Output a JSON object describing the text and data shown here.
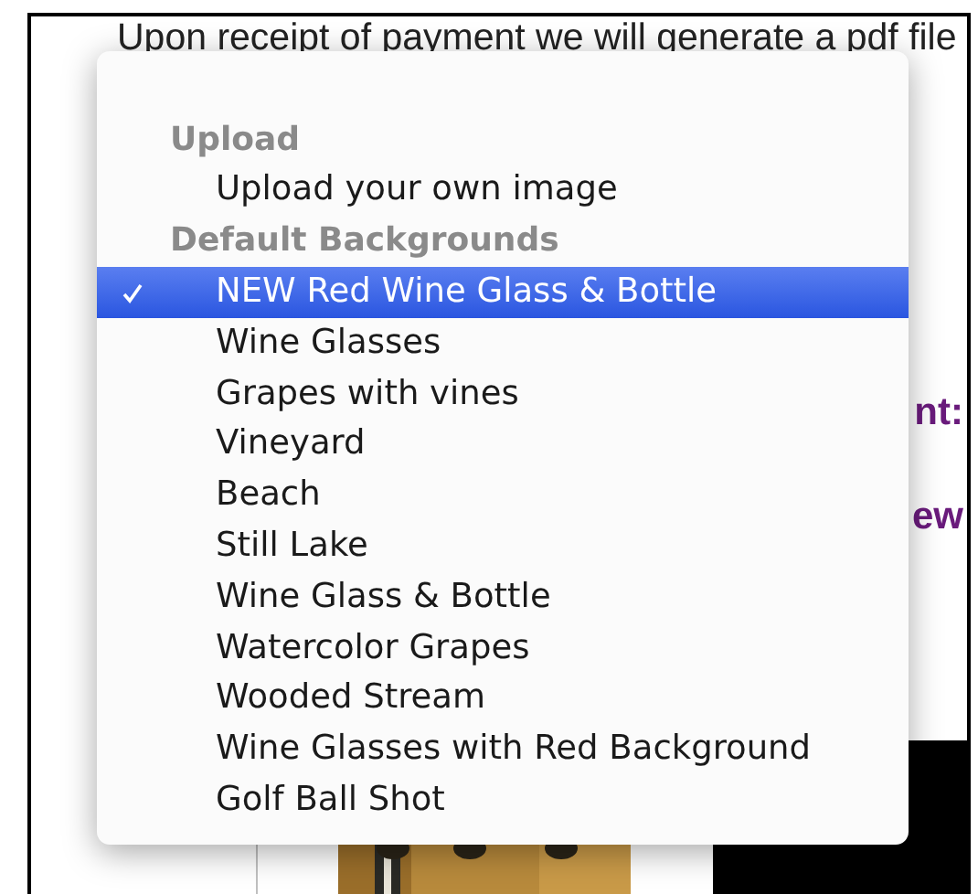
{
  "page": {
    "intro_text": "Upon receipt of payment we will generate a pdf file",
    "font_label": "nt:",
    "preview_label": "ew"
  },
  "menu": {
    "items": [
      {
        "kind": "header",
        "label": "Upload"
      },
      {
        "kind": "option",
        "label": "Upload your own image",
        "selected": false
      },
      {
        "kind": "header",
        "label": "Default Backgrounds"
      },
      {
        "kind": "option",
        "label": "NEW Red Wine Glass & Bottle",
        "selected": true
      },
      {
        "kind": "option",
        "label": "Wine Glasses",
        "selected": false
      },
      {
        "kind": "option",
        "label": "Grapes with vines",
        "selected": false
      },
      {
        "kind": "option",
        "label": "Vineyard",
        "selected": false
      },
      {
        "kind": "option",
        "label": "Beach",
        "selected": false
      },
      {
        "kind": "option",
        "label": "Still Lake",
        "selected": false
      },
      {
        "kind": "option",
        "label": "Wine Glass & Bottle",
        "selected": false
      },
      {
        "kind": "option",
        "label": "Watercolor Grapes",
        "selected": false
      },
      {
        "kind": "option",
        "label": "Wooded Stream",
        "selected": false
      },
      {
        "kind": "option",
        "label": "Wine Glasses with Red Background",
        "selected": false
      },
      {
        "kind": "option",
        "label": "Golf Ball Shot",
        "selected": false
      }
    ]
  }
}
